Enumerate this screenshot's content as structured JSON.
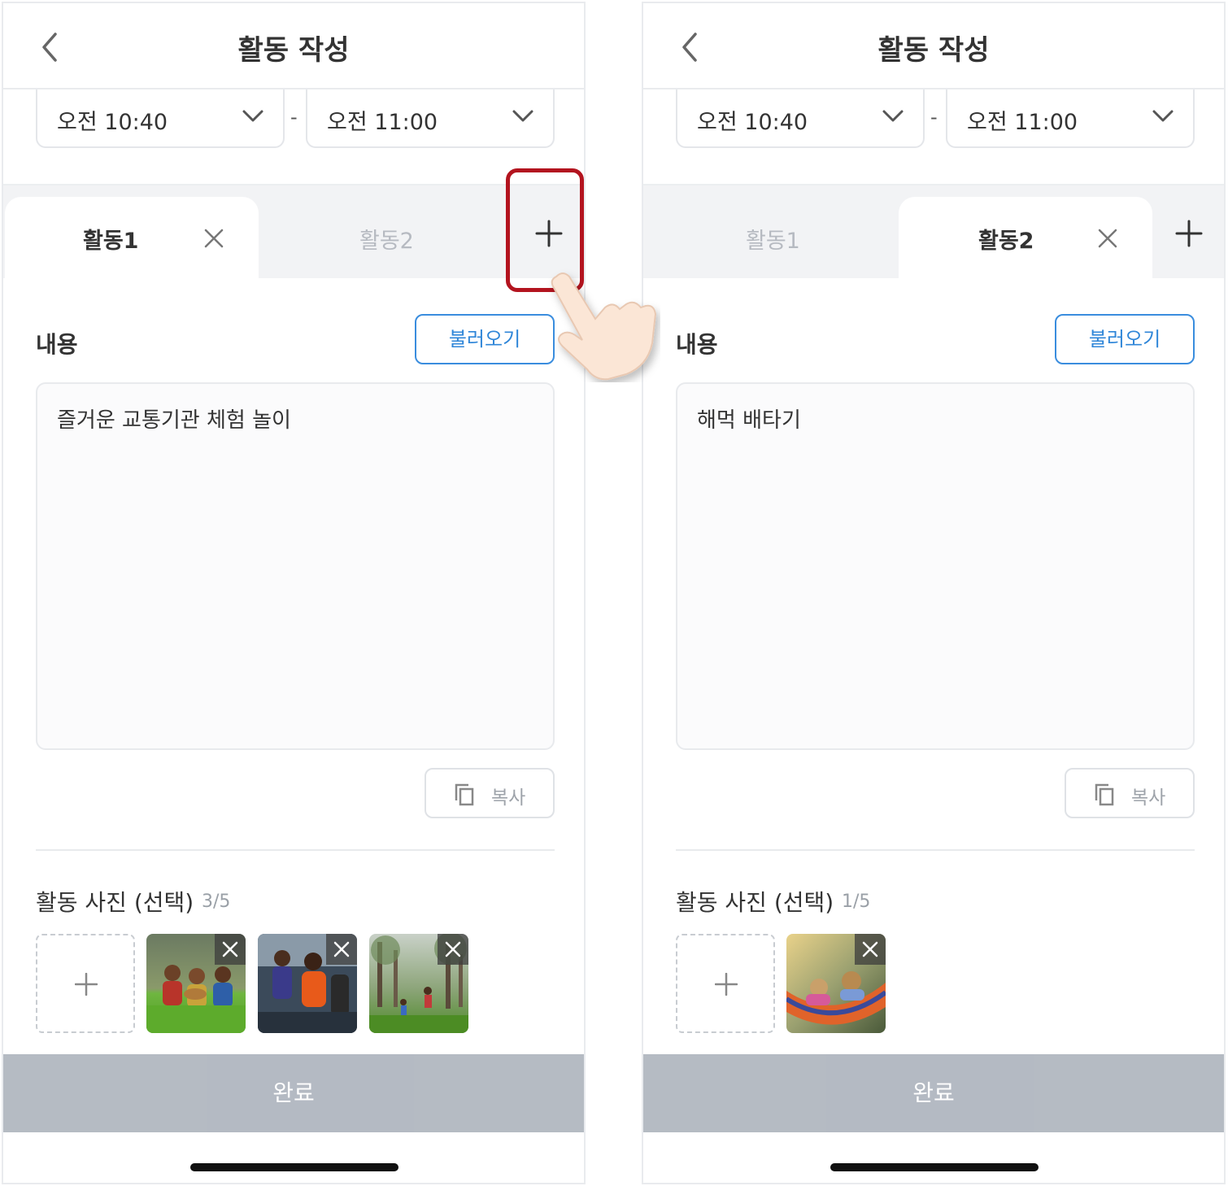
{
  "screens": [
    {
      "header": {
        "title": "활동 작성"
      },
      "time": {
        "start": "오전 10:40",
        "separator": "-",
        "end": "오전 11:00"
      },
      "tabs": [
        {
          "label": "활동1",
          "active": true
        },
        {
          "label": "활동2",
          "active": false
        }
      ],
      "content": {
        "label": "내용",
        "load_button": "불러오기",
        "text": "즐거운 교통기관 체험 놀이",
        "copy_button": "복사"
      },
      "photos": {
        "title": "활동 사진 (선택)",
        "count": "3/5",
        "thumbnails": [
          "kids-with-ukuleles-photo",
          "kids-dancing-photo",
          "kids-playing-in-park-photo"
        ]
      },
      "done_button": "완료"
    },
    {
      "header": {
        "title": "활동 작성"
      },
      "time": {
        "start": "오전 10:40",
        "separator": "-",
        "end": "오전 11:00"
      },
      "tabs": [
        {
          "label": "활동1",
          "active": false
        },
        {
          "label": "활동2",
          "active": true
        }
      ],
      "content": {
        "label": "내용",
        "load_button": "불러오기",
        "text": "해먹 배타기",
        "copy_button": "복사"
      },
      "photos": {
        "title": "활동 사진 (선택)",
        "count": "1/5",
        "thumbnails": [
          "kids-in-hammock-photo"
        ]
      },
      "done_button": "완료"
    }
  ],
  "icons": [
    "back-arrow-icon",
    "chevron-down-icon",
    "close-icon",
    "plus-icon",
    "copy-icon",
    "pointing-hand-icon"
  ],
  "colors": {
    "accent": "#2f86d8",
    "highlight": "#b3141f",
    "done_bar": "#b1b7c0"
  }
}
